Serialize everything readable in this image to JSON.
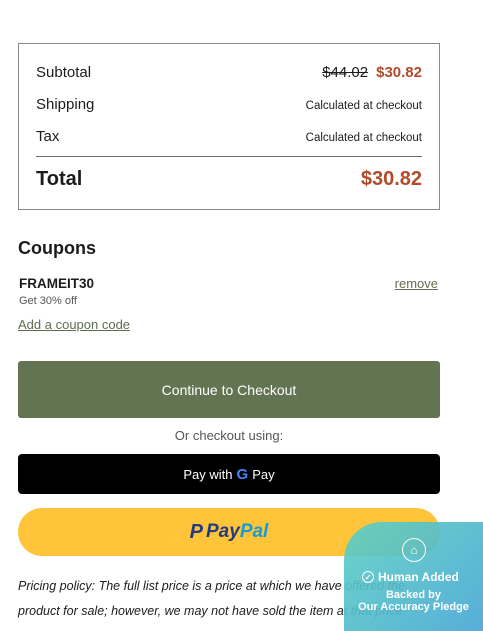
{
  "summary": {
    "subtotal_label": "Subtotal",
    "subtotal_original": "$44.02",
    "subtotal_sale": "$30.82",
    "shipping_label": "Shipping",
    "shipping_value": "Calculated at checkout",
    "tax_label": "Tax",
    "tax_value": "Calculated at checkout",
    "total_label": "Total",
    "total_value": "$30.82"
  },
  "coupons": {
    "title": "Coupons",
    "code": "FRAMEIT30",
    "description": "Get 30% off",
    "remove_label": "remove",
    "add_label": "Add a coupon code"
  },
  "checkout": {
    "continue_label": "Continue to Checkout",
    "or_label": "Or checkout using:",
    "gpay_prefix": "Pay with",
    "gpay_g": "G",
    "gpay_suffix": "Pay",
    "paypal_p": "P",
    "paypal_pay": "Pay",
    "paypal_pal": "Pal"
  },
  "policy": {
    "text": "Pricing policy: The full list price is a price at which we have offered the product for sale; however, we may not have sold the item at that price."
  },
  "badge": {
    "line1": "Human Added",
    "line2": "Backed by",
    "line3": "Our Accuracy Pledge",
    "icon": "home-icon"
  },
  "colors": {
    "accent_green": "#637453",
    "sale_red": "#b14b2a",
    "paypal_yellow": "#ffc439",
    "paypal_blue_dark": "#253b80",
    "paypal_blue_light": "#179bd7"
  }
}
